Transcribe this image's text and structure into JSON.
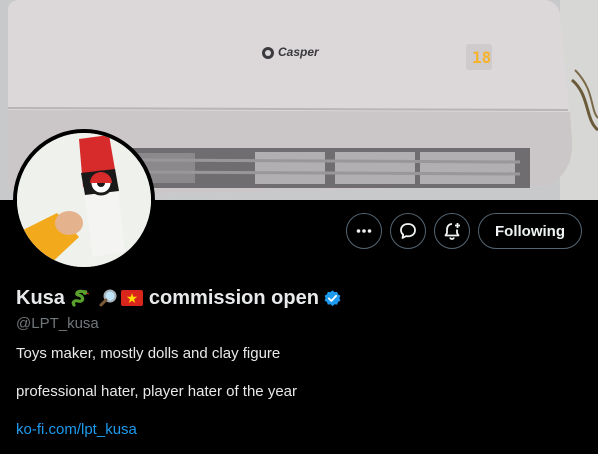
{
  "banner": {
    "brand_text": "Casper",
    "display_text": "18"
  },
  "profile": {
    "name": "Kusa",
    "name_tail": "commission open",
    "handle": "@LPT_kusa",
    "bio_line1": "Toys maker, mostly dolls and clay figure",
    "bio_line2": "professional hater, player hater of the year",
    "link": "ko-fi.com/lpt_kusa"
  },
  "actions": {
    "more_icon": "more-icon",
    "message_icon": "message-icon",
    "notify_icon": "notify-bell-icon",
    "follow_label": "Following"
  },
  "colors": {
    "background": "#000000",
    "text_primary": "#e7e9ea",
    "text_secondary": "#71767b",
    "link": "#1d9bf0",
    "verified": "#1d9bf0",
    "button_border": "#536471"
  }
}
